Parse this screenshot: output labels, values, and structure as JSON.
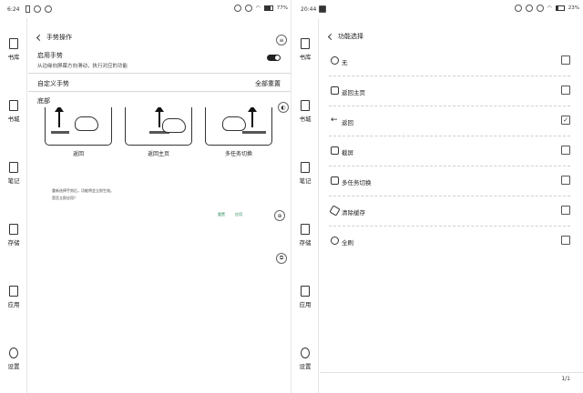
{
  "left_status": {
    "time": "6:24",
    "battery": "77%",
    "battery_level": 0.77
  },
  "right_status": {
    "time": "20:44",
    "battery": "23%",
    "battery_level": 0.23
  },
  "nav": {
    "items": [
      {
        "label": "书库",
        "icon": "bookshelf-icon"
      },
      {
        "label": "书城",
        "icon": "bookstore-icon"
      },
      {
        "label": "笔记",
        "icon": "note-icon"
      },
      {
        "label": "存储",
        "icon": "folder-icon"
      },
      {
        "label": "应用",
        "icon": "apps-icon"
      },
      {
        "label": "设置",
        "icon": "gear-icon"
      }
    ]
  },
  "gesture": {
    "title": "手势操作",
    "enable_title": "启用手势",
    "enable_desc": "从边缘向屏幕方向滑动，执行对应的功能",
    "custom_label": "自定义手势",
    "reset_all": "全部重置",
    "section_bottom": "底部",
    "tiles": [
      "返回",
      "返回主页",
      "多任务切换"
    ],
    "hint_line1": "重新选择手势后，功能将会立即生效。",
    "hint_line2": "是否立即应用？",
    "link_reset": "重置",
    "link_apply": "应用"
  },
  "function_select": {
    "title": "功能选择",
    "options": [
      {
        "label": "无",
        "icon": "none-icon",
        "checked": false
      },
      {
        "label": "返回主页",
        "icon": "home-icon",
        "checked": false
      },
      {
        "label": "返回",
        "icon": "back-arrow-icon",
        "checked": true
      },
      {
        "label": "截屏",
        "icon": "screenshot-icon",
        "checked": false
      },
      {
        "label": "多任务切换",
        "icon": "multitask-icon",
        "checked": false
      },
      {
        "label": "清除缓存",
        "icon": "broom-icon",
        "checked": false
      },
      {
        "label": "全刷",
        "icon": "refresh-icon",
        "checked": false
      }
    ],
    "pager": "1/1"
  }
}
